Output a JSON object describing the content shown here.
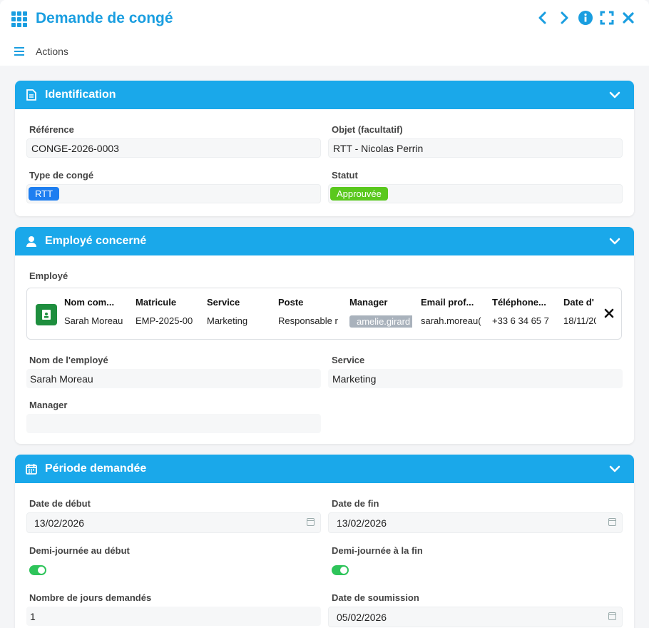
{
  "window": {
    "title": "Demande de congé"
  },
  "actions": {
    "label": "Actions"
  },
  "identification": {
    "header": "Identification",
    "reference_label": "Référence",
    "reference_value": "CONGE-2026-0003",
    "objet_label": "Objet (facultatif)",
    "objet_value": "RTT - Nicolas Perrin",
    "type_label": "Type de congé",
    "type_value": "RTT",
    "statut_label": "Statut",
    "statut_value": "Approuvée"
  },
  "employe": {
    "header": "Employé concerné",
    "employe_label": "Employé",
    "columns": [
      {
        "header": "Nom com...",
        "value": "Sarah Moreau"
      },
      {
        "header": "Matricule",
        "value": "EMP-2025-00"
      },
      {
        "header": "Service",
        "value": "Marketing"
      },
      {
        "header": "Poste",
        "value": "Responsable r"
      },
      {
        "header": "Manager",
        "value": "amelie.girard"
      },
      {
        "header": "Email prof...",
        "value": "sarah.moreau("
      },
      {
        "header": "Téléphone...",
        "value": "+33 6 34 65 7"
      },
      {
        "header": "Date d'",
        "value": "18/11/20"
      }
    ],
    "nom_label": "Nom de l'employé",
    "nom_value": "Sarah Moreau",
    "service_label": "Service",
    "service_value": "Marketing",
    "manager_label": "Manager",
    "manager_value": ""
  },
  "periode": {
    "header": "Période demandée",
    "debut_label": "Date de début",
    "debut_value": "13/02/2026",
    "fin_label": "Date de fin",
    "fin_value": "13/02/2026",
    "demi_debut_label": "Demi-journée au début",
    "demi_fin_label": "Demi-journée à la fin",
    "nb_jours_label": "Nombre de jours demandés",
    "nb_jours_value": "1",
    "soumission_label": "Date de soumission",
    "soumission_value": "05/02/2026"
  },
  "colors": {
    "accent": "#1aa8ea",
    "rtt_badge": "#1e7ef0",
    "approved_badge": "#5ac81e"
  }
}
